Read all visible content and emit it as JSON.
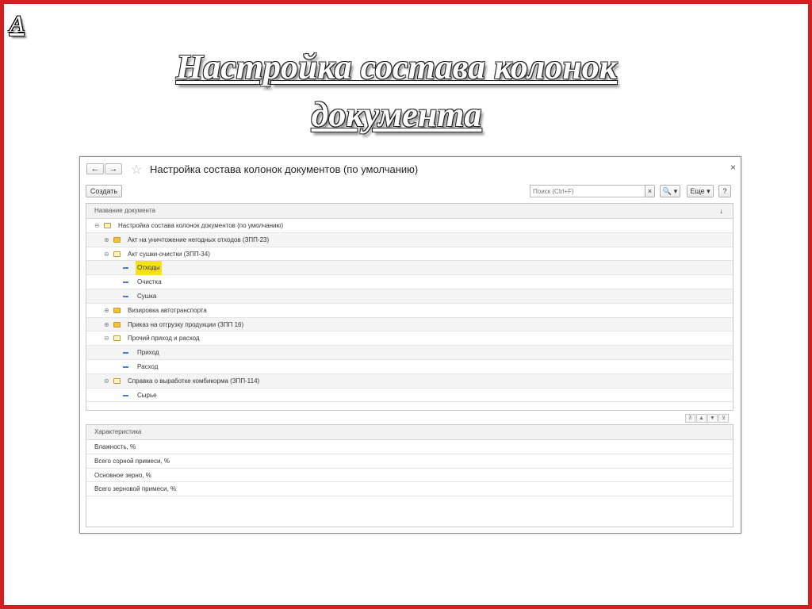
{
  "slide": {
    "corner_letter": "А",
    "title_line1": "Настройка состава колонок",
    "title_line2": "документа"
  },
  "window": {
    "back_icon": "←",
    "forward_icon": "→",
    "star_icon": "☆",
    "title": "Настройка состава колонок документов (по умолчанию)",
    "close_icon": "×"
  },
  "toolbar": {
    "create_label": "Создать",
    "search_placeholder": "Поиск (Ctrl+F)",
    "clear_icon": "×",
    "search_btn_label": "🔍 ▾",
    "more_label": "Еще ▾",
    "help_label": "?"
  },
  "top_grid": {
    "header": "Название документа",
    "sort_icon": "↓",
    "rows": [
      {
        "label": "Настройка состава колонок документов (по умолчанию)"
      },
      {
        "label": "Акт на уничтожение негодных отходов (ЗПП-23)"
      },
      {
        "label": "Акт сушки-очистки (ЗПП-34)"
      },
      {
        "label": "Отходы"
      },
      {
        "label": "Очистка"
      },
      {
        "label": "Сушка"
      },
      {
        "label": "Визировка автотранспорта"
      },
      {
        "label": "Приказ на отгрузку продукции (ЗПП 16)"
      },
      {
        "label": "Прочий приход и расход"
      },
      {
        "label": "Приход"
      },
      {
        "label": "Расход"
      },
      {
        "label": "Справка о выработке комбикорма (ЗПП-114)"
      },
      {
        "label": "Сырье"
      }
    ]
  },
  "scroll_controls": [
    "⊼",
    "▲",
    "▼",
    "⊻"
  ],
  "bottom_grid": {
    "header": "Характеристика",
    "rows": [
      {
        "label": "Влажность, %"
      },
      {
        "label": "Всего сорной примеси, %"
      },
      {
        "label": "Основное зерно, %"
      },
      {
        "label": "Всего зерновой примеси, %"
      }
    ]
  },
  "colors": {
    "frame": "#d21f1f",
    "highlight": "#f5e11b",
    "folder": "#f0c040",
    "dash": "#4a7bd0"
  }
}
